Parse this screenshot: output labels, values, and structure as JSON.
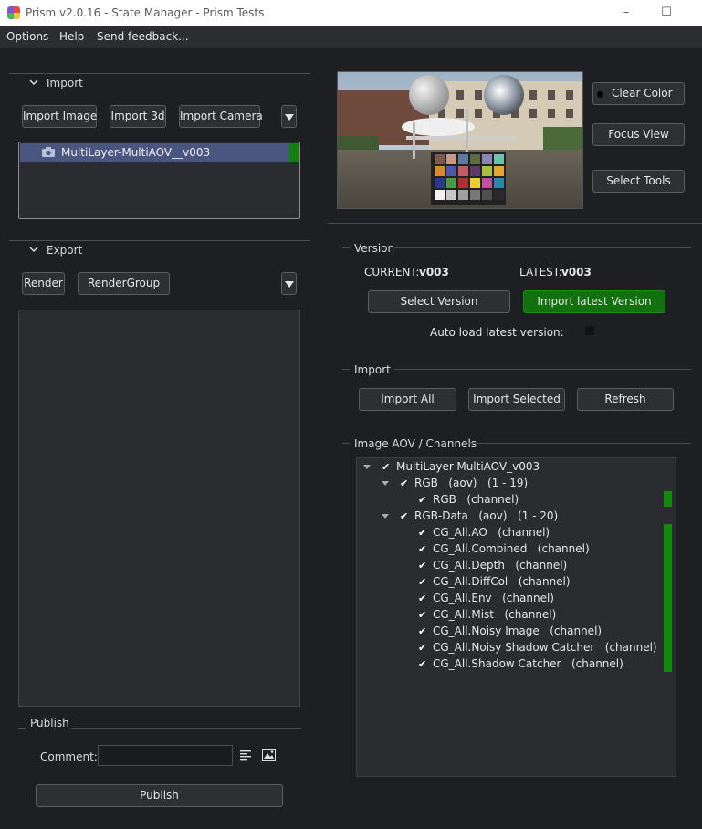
{
  "window": {
    "title": "Prism v2.0.16 - State Manager - Prism Tests"
  },
  "menu": [
    "Options",
    "Help",
    "Send feedback..."
  ],
  "import_section": {
    "label": "Import",
    "buttons": [
      "Import Image",
      "Import 3d",
      "Import Camera"
    ],
    "items": [
      {
        "name": "MultiLayer-MultiAOV__v003",
        "icon": "camera-icon"
      }
    ]
  },
  "export_section": {
    "label": "Export",
    "buttons": [
      "Render",
      "RenderGroup"
    ]
  },
  "publish": {
    "label": "Publish",
    "comment_label": "Comment:",
    "comment_value": "",
    "button": "Publish"
  },
  "preview_buttons": {
    "clear_color": "Clear Color",
    "focus_view": "Focus View",
    "select_tools": "Select Tools"
  },
  "version": {
    "label": "Version",
    "current_label": "CURRENT:",
    "current_value": "v003",
    "latest_label": "LATEST:",
    "latest_value": "v003",
    "select_button": "Select Version",
    "import_latest_button": "Import latest Version",
    "auto_load_label": "Auto load latest version:"
  },
  "import_actions": {
    "label": "Import",
    "buttons": [
      "Import All",
      "Import Selected",
      "Refresh"
    ]
  },
  "aov": {
    "label": "Image AOV / Channels",
    "root": "MultiLayer-MultiAOV_v003",
    "groups": [
      {
        "name": "RGB",
        "type": "(aov)",
        "range": "(1 - 19)",
        "channels": [
          {
            "name": "RGB",
            "type": "(channel)"
          }
        ]
      },
      {
        "name": "RGB-Data",
        "type": "(aov)",
        "range": "(1 - 20)",
        "channels": [
          {
            "name": "CG_All.AO",
            "type": "(channel)"
          },
          {
            "name": "CG_All.Combined",
            "type": "(channel)"
          },
          {
            "name": "CG_All.Depth",
            "type": "(channel)"
          },
          {
            "name": "CG_All.DiffCol",
            "type": "(channel)"
          },
          {
            "name": "CG_All.Env",
            "type": "(channel)"
          },
          {
            "name": "CG_All.Mist",
            "type": "(channel)"
          },
          {
            "name": "CG_All.Noisy Image",
            "type": "(channel)"
          },
          {
            "name": "CG_All.Noisy Shadow Catcher",
            "type": "(channel)"
          },
          {
            "name": "CG_All.Shadow Catcher",
            "type": "(channel)"
          }
        ]
      }
    ]
  },
  "colors": {
    "accent_green": "#13700f",
    "selection": "#4a5580",
    "background": "#1e1f22"
  }
}
